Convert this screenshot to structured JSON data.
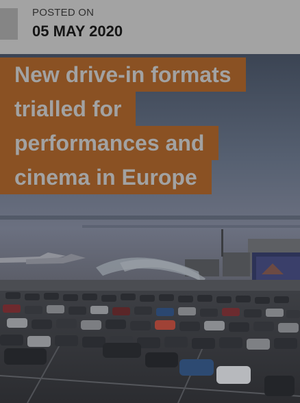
{
  "post": {
    "posted_label": "POSTED ON",
    "date": "05 MAY 2020",
    "title_lines": [
      "New drive-in formats",
      "trialled for",
      "performances and",
      "cinema in Europe"
    ]
  },
  "icons": {
    "hero": "drive-in-photo"
  },
  "colors": {
    "header_band": "#a3a3a3",
    "headline_bg": "#8a5123",
    "headline_text": "#a2a2a2",
    "overlay": "#6a6a6a"
  }
}
